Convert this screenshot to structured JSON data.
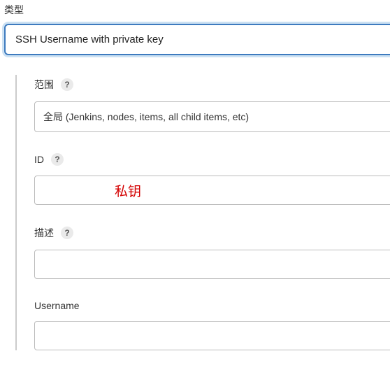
{
  "type": {
    "label": "类型",
    "selected": "SSH Username with private key"
  },
  "scope": {
    "label": "范围",
    "selected": "全局 (Jenkins, nodes, items, all child items, etc)"
  },
  "id": {
    "label": "ID",
    "value": ""
  },
  "description": {
    "label": "描述",
    "value": ""
  },
  "username": {
    "label": "Username",
    "value": ""
  },
  "help_glyph": "?",
  "annotation": {
    "id_note": "私钥"
  }
}
